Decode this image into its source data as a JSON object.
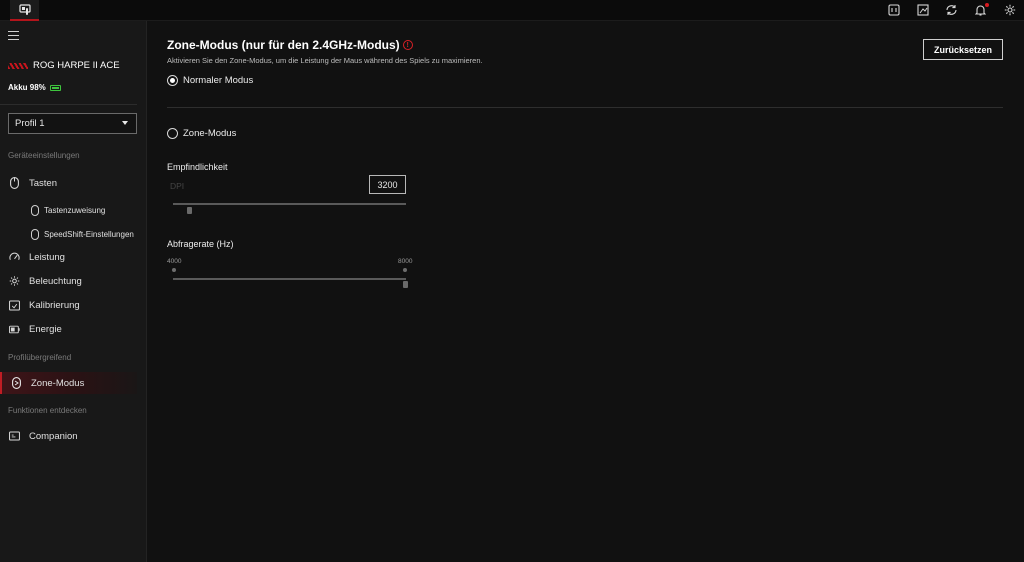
{
  "topbar": {
    "app_icon": "mouse-device-icon",
    "icons": [
      "keyboard-shortcut-icon",
      "image-edit-icon",
      "sync-icon",
      "bell-icon",
      "gear-icon"
    ]
  },
  "sidebar": {
    "device_name": "ROG HARPE II ACE",
    "battery_label": "Akku 98%",
    "battery_level": 0.98,
    "profile": "Profil 1",
    "section_device": "Geräteeinstellungen",
    "section_cross": "Profilübergreifend",
    "section_discover": "Funktionen entdecken",
    "items": {
      "tasten": "Tasten",
      "tastenzuweisung": "Tastenzuweisung",
      "speedshift": "SpeedShift-Einstellungen",
      "leistung": "Leistung",
      "beleuchtung": "Beleuchtung",
      "kalibrierung": "Kalibrierung",
      "energie": "Energie",
      "zone_modus": "Zone-Modus",
      "companion": "Companion"
    }
  },
  "main": {
    "title": "Zone-Modus (nur für den 2.4GHz-Modus)",
    "description": "Aktivieren Sie den Zone-Modus, um die Leistung der Maus während des Spiels zu maximieren.",
    "reset_label": "Zurücksetzen",
    "mode_normal": "Normaler Modus",
    "mode_zone": "Zone-Modus",
    "selected_mode": "Normaler Modus",
    "sensitivity_label": "Empfindlichkeit",
    "dpi_label": "DPI",
    "dpi_value": "3200",
    "dpi_slider_fraction": 0.07,
    "polling_label": "Abfragerate (Hz)",
    "polling_min": "4000",
    "polling_max": "8000",
    "polling_selected": 8000
  },
  "colors": {
    "accent": "#c01d24",
    "battery": "#3ec43e"
  }
}
